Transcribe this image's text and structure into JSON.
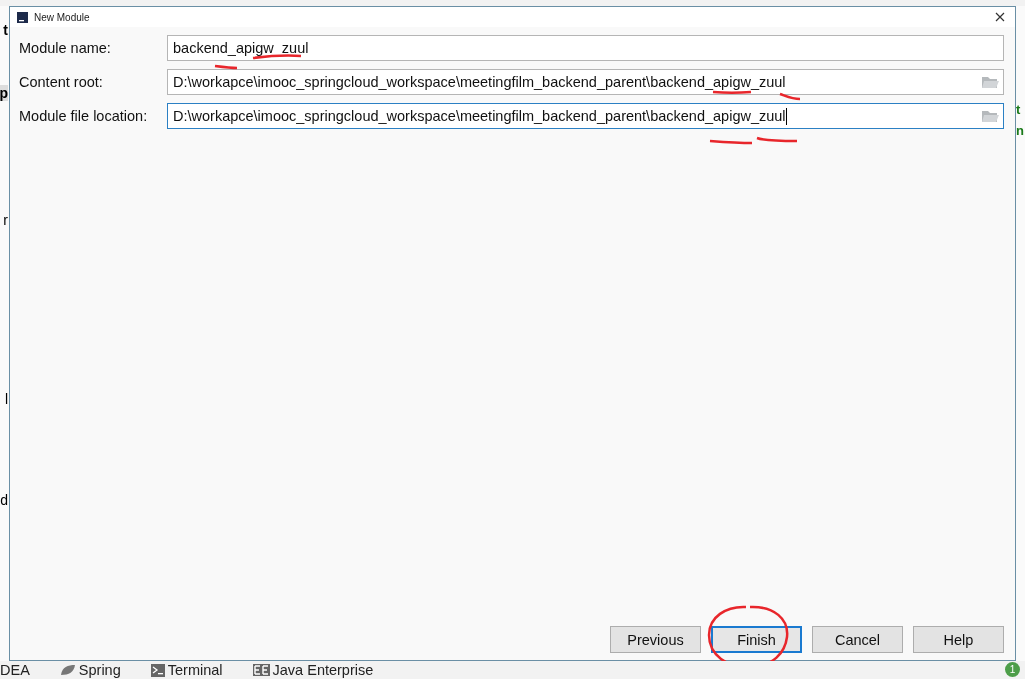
{
  "ide_left_fragments": [
    "t",
    "p",
    "r",
    "l",
    "d"
  ],
  "ide_right_fragments": [
    "t",
    "n"
  ],
  "dialog": {
    "title": "New Module",
    "fields": [
      {
        "label": "Module name:",
        "value": "backend_apigw_zuul",
        "kind": "text",
        "focused": false
      },
      {
        "label": "Content root:",
        "value": "D:\\workapce\\imooc_springcloud_workspace\\meetingfilm_backend_parent\\backend_apigw_zuul",
        "kind": "path",
        "focused": false
      },
      {
        "label": "Module file location:",
        "value": "D:\\workapce\\imooc_springcloud_workspace\\meetingfilm_backend_parent\\backend_apigw_zuul",
        "kind": "path",
        "focused": true
      }
    ],
    "buttons": [
      {
        "label": "Previous",
        "focused": false
      },
      {
        "label": "Finish",
        "focused": true
      },
      {
        "label": "Cancel",
        "focused": false
      },
      {
        "label": "Help",
        "focused": false
      }
    ]
  },
  "status_bar": {
    "tabs": [
      {
        "label": "DEA",
        "kind": "plain"
      },
      {
        "label": "Spring",
        "kind": "spring"
      },
      {
        "label": "Terminal",
        "kind": "terminal"
      },
      {
        "label": "Java Enterprise",
        "kind": "ee"
      }
    ],
    "badge": "1"
  }
}
